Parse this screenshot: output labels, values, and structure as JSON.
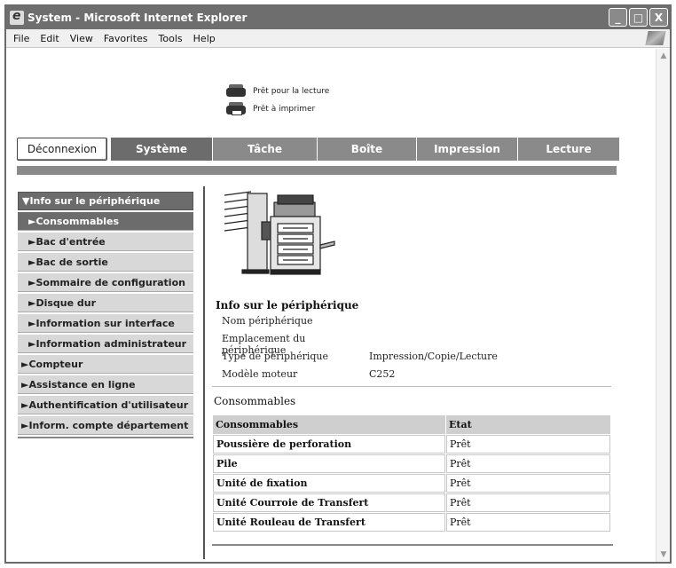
{
  "window": {
    "title": "System - Microsoft Internet Explorer",
    "buttons": {
      "minimize": "_",
      "maximize": "□",
      "close": "X"
    }
  },
  "menu": [
    "File",
    "Edit",
    "View",
    "Favorites",
    "Tools",
    "Help"
  ],
  "status": {
    "scan": "Prêt pour la lecture",
    "print": "Prêt à imprimer"
  },
  "tabs": {
    "logout": "Déconnexion",
    "items": [
      "Système",
      "Tâche",
      "Boîte",
      "Impression",
      "Lecture"
    ]
  },
  "sidebar": {
    "header": "▼Info sur le périphérique",
    "items": [
      {
        "label": "►Consommables",
        "selected": true
      },
      {
        "label": "►Bac d'entrée"
      },
      {
        "label": "►Bac de sortie"
      },
      {
        "label": "►Sommaire de configuration"
      },
      {
        "label": "►Disque dur"
      },
      {
        "label": "►Information sur interface"
      },
      {
        "label": "►Information administrateur"
      }
    ],
    "top_items": [
      "►Compteur",
      "►Assistance en ligne",
      "►Authentification d'utilisateur",
      "►Inform. compte département"
    ]
  },
  "device_info": {
    "title": "Info sur le périphérique",
    "rows": [
      {
        "label": "Nom périphérique",
        "value": ""
      },
      {
        "label": "Emplacement du périphérique",
        "value": ""
      },
      {
        "label": "Type de périphérique",
        "value": "Impression/Copie/Lecture"
      },
      {
        "label": "Modèle moteur",
        "value": "C252"
      }
    ]
  },
  "consumables": {
    "title": "Consommables",
    "headers": [
      "Consommables",
      "Etat"
    ],
    "rows": [
      [
        "Poussière de perforation",
        "Prêt"
      ],
      [
        "Pile",
        "Prêt"
      ],
      [
        "Unité de fixation",
        "Prêt"
      ],
      [
        "Unité Courroie de Transfert",
        "Prêt"
      ],
      [
        "Unité Rouleau de Transfert",
        "Prêt"
      ]
    ]
  }
}
